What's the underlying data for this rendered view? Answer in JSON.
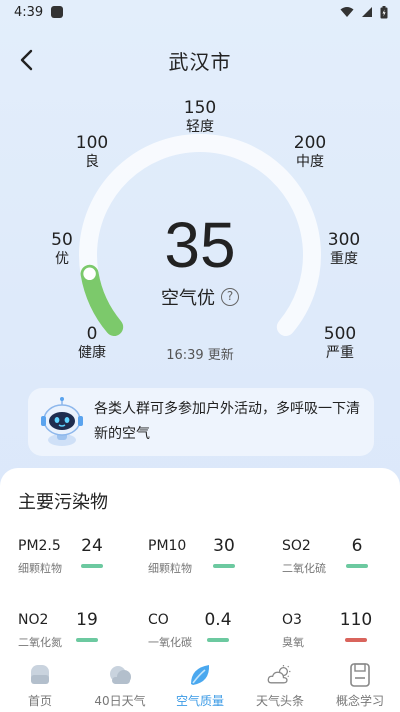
{
  "status_bar": {
    "time": "4:39"
  },
  "header": {
    "title": "武汉市"
  },
  "gauge": {
    "scale": [
      {
        "value": "0",
        "desc": "健康"
      },
      {
        "value": "50",
        "desc": "优"
      },
      {
        "value": "100",
        "desc": "良"
      },
      {
        "value": "150",
        "desc": "轻度"
      },
      {
        "value": "200",
        "desc": "中度"
      },
      {
        "value": "300",
        "desc": "重度"
      },
      {
        "value": "500",
        "desc": "严重"
      }
    ],
    "aqi": "35",
    "aqi_numeric": 35,
    "level": "空气优",
    "update": "16:39 更新",
    "colors": {
      "track": "#ffffff",
      "fill": "#7cc96b",
      "knob": "#ffffff"
    }
  },
  "advice": {
    "text": "各类人群可多参加户外活动，多呼吸一下清新的空气"
  },
  "pollutants": {
    "title": "主要污染物",
    "items": [
      {
        "name": "PM2.5",
        "sub": "细颗粒物",
        "value": "24",
        "color": "#6cc9a0"
      },
      {
        "name": "PM10",
        "sub": "细颗粒物",
        "value": "30",
        "color": "#6cc9a0"
      },
      {
        "name": "SO2",
        "sub": "二氧化硫",
        "value": "6",
        "color": "#6cc9a0"
      },
      {
        "name": "NO2",
        "sub": "二氧化氮",
        "value": "19",
        "color": "#6cc9a0"
      },
      {
        "name": "CO",
        "sub": "一氧化碳",
        "value": "0.4",
        "color": "#6cc9a0"
      },
      {
        "name": "O3",
        "sub": "臭氧",
        "value": "110",
        "color": "#d9645c"
      }
    ]
  },
  "tabs": [
    {
      "label": "首页",
      "icon": "home-icon",
      "active": false
    },
    {
      "label": "40日天气",
      "icon": "cloud-icon",
      "active": false
    },
    {
      "label": "空气质量",
      "icon": "leaf-icon",
      "active": true
    },
    {
      "label": "天气头条",
      "icon": "sun-cloud-icon",
      "active": false
    },
    {
      "label": "概念学习",
      "icon": "book-icon",
      "active": false
    }
  ],
  "accent_color": "#3c9be6"
}
